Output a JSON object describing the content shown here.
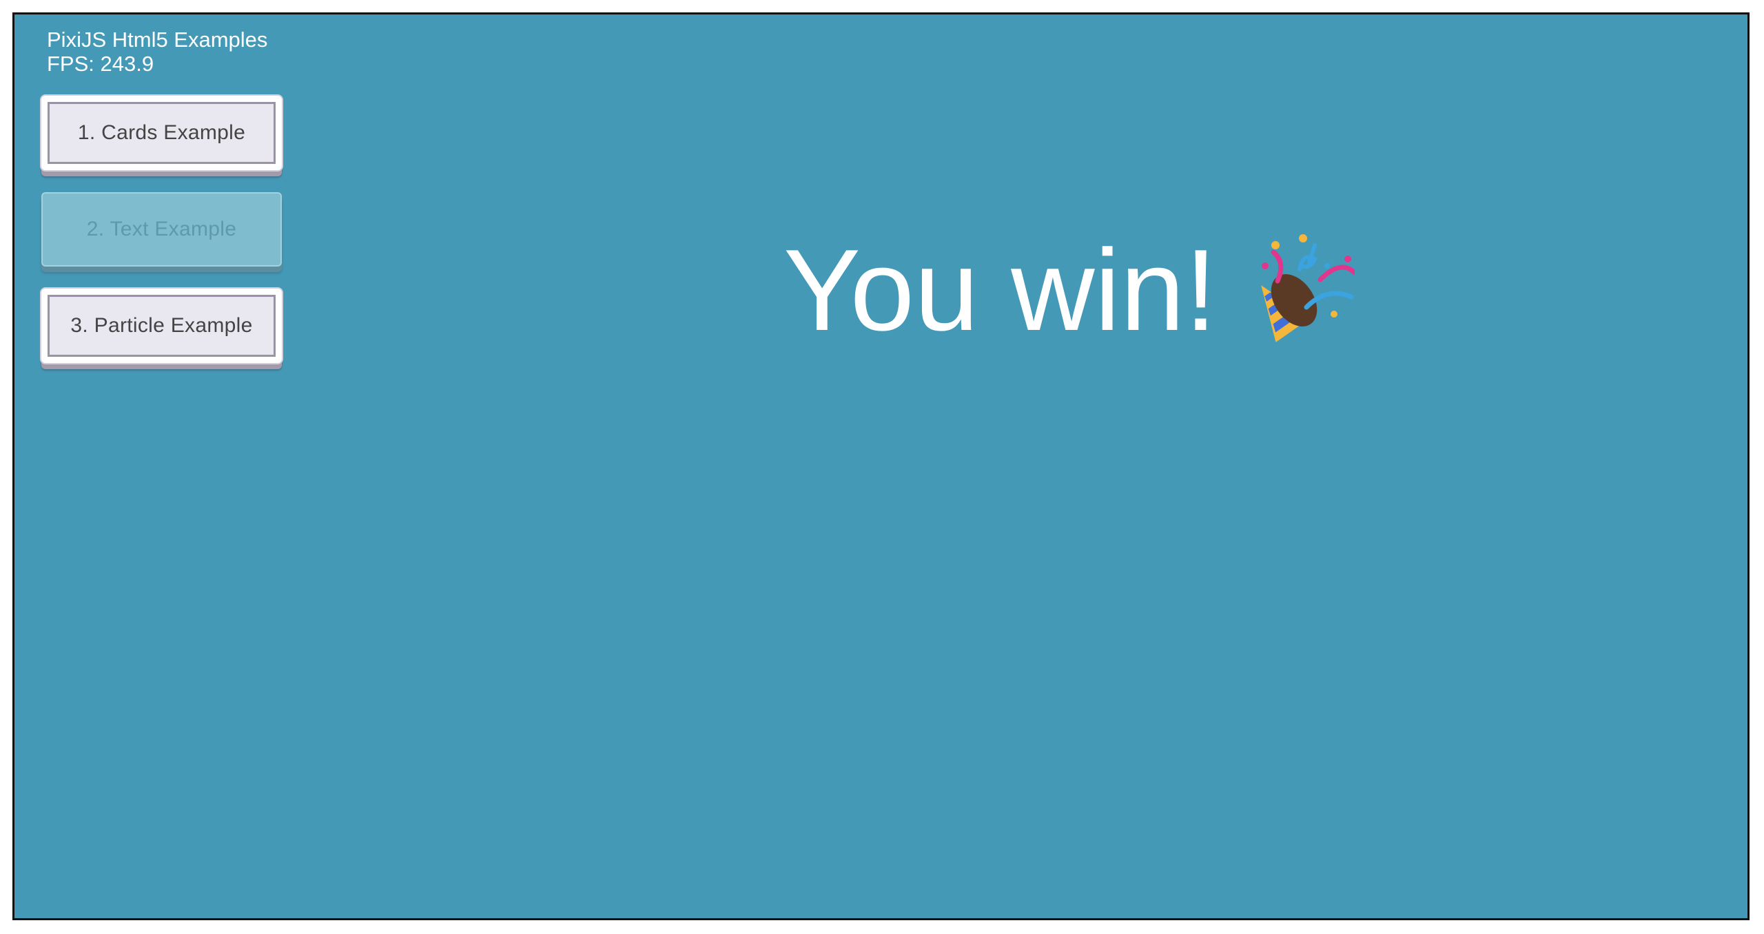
{
  "hud": {
    "title": "PixiJS Html5 Examples",
    "fps": "FPS: 243.9"
  },
  "menu": {
    "items": [
      {
        "label": "1. Cards Example",
        "state": "enabled"
      },
      {
        "label": "2. Text Example",
        "state": "disabled"
      },
      {
        "label": "3. Particle Example",
        "state": "enabled"
      }
    ]
  },
  "scene": {
    "message": "You win!",
    "emoji_icon": "party-popper-icon"
  },
  "colors": {
    "stage_background": "#4499b7",
    "button_face": "#e9e7ef",
    "button_disabled": "#7fbccd",
    "text_white": "#ffffff"
  }
}
